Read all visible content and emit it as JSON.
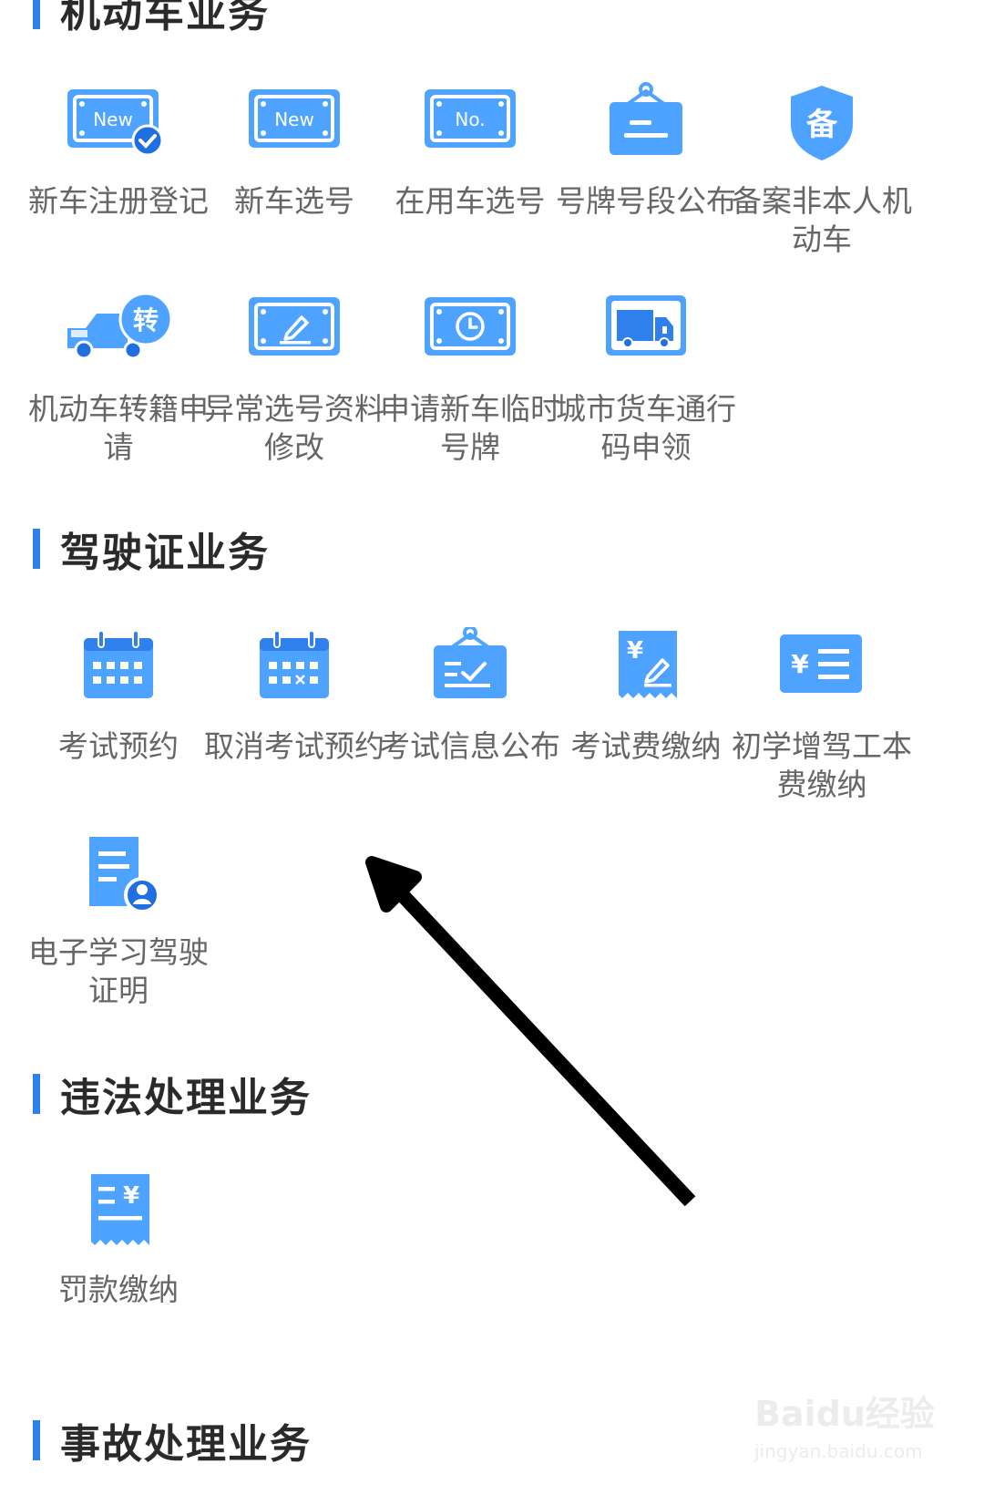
{
  "sections": {
    "vehicle": {
      "title": "机动车业务"
    },
    "license": {
      "title": "驾驶证业务"
    },
    "violation": {
      "title": "违法处理业务"
    },
    "accident": {
      "title": "事故处理业务"
    }
  },
  "vehicle_items": [
    {
      "label": "新车注册登记",
      "icon": "new-plate-check-icon"
    },
    {
      "label": "新车选号",
      "icon": "new-plate-icon"
    },
    {
      "label": "在用车选号",
      "icon": "no-plate-icon"
    },
    {
      "label": "号牌号段公布",
      "icon": "hanging-sign-icon"
    },
    {
      "label": "备案非本人机动车",
      "icon": "shield-record-icon"
    },
    {
      "label": "机动车转籍申请",
      "icon": "truck-transfer-icon"
    },
    {
      "label": "异常选号资料修改",
      "icon": "plate-edit-icon"
    },
    {
      "label": "申请新车临时号牌",
      "icon": "plate-clock-icon"
    },
    {
      "label": "城市货车通行码申领",
      "icon": "truck-pass-icon"
    }
  ],
  "license_items": [
    {
      "label": "考试预约",
      "icon": "calendar-icon"
    },
    {
      "label": "取消考试预约",
      "icon": "calendar-cancel-icon"
    },
    {
      "label": "考试信息公布",
      "icon": "hanging-sign-check-icon"
    },
    {
      "label": "考试费缴纳",
      "icon": "fee-receipt-icon"
    },
    {
      "label": "初学增驾工本费缴纳",
      "icon": "fee-card-icon"
    },
    {
      "label": "电子学习驾驶证明",
      "icon": "document-user-icon"
    }
  ],
  "violation_items": [
    {
      "label": "罚款缴纳",
      "icon": "fine-receipt-icon"
    }
  ],
  "icon_text": {
    "new": "New",
    "no": "No.",
    "bei": "备",
    "zhuan": "转",
    "yen": "¥"
  },
  "watermark": {
    "brand": "Baidu经验",
    "url": "jingyan.baidu.com"
  },
  "colors": {
    "accent": "#2f80ed",
    "icon_light": "#4da3ff",
    "icon_dark": "#1f6fe0"
  }
}
